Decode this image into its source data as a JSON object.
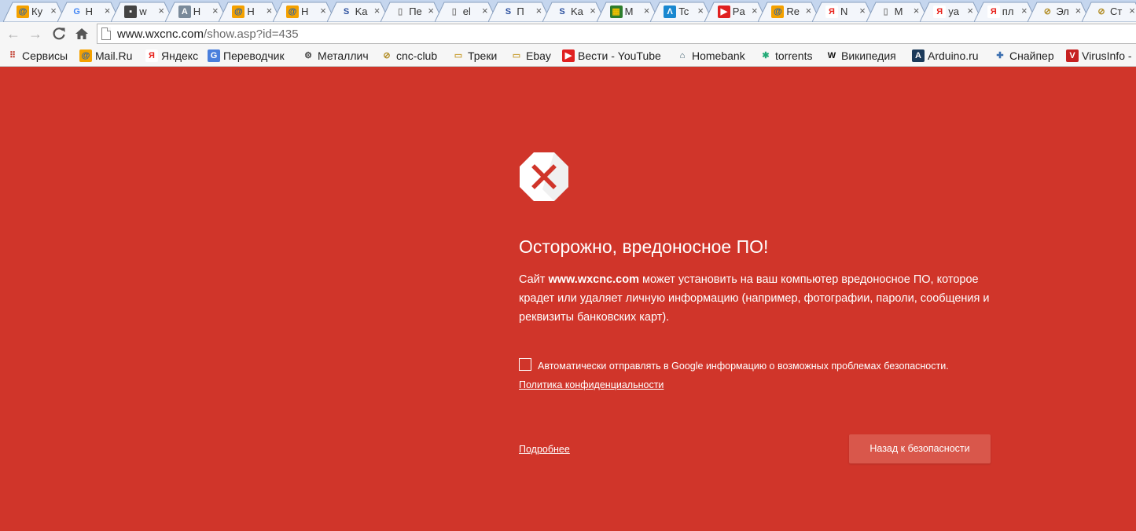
{
  "colors": {
    "page_background": "#d0352a",
    "tabstrip_background": "#c5d6ee",
    "button_background": "#d9574b",
    "text": "#ffffff"
  },
  "tabs": [
    {
      "title": "Ку",
      "icon": "mail-ru-icon"
    },
    {
      "title": "H",
      "icon": "google-icon"
    },
    {
      "title": "w",
      "icon": "site-logo-icon"
    },
    {
      "title": "H",
      "icon": "page-scan-icon"
    },
    {
      "title": "H",
      "icon": "mail-ru-icon"
    },
    {
      "title": "H",
      "icon": "mail-ru-icon"
    },
    {
      "title": "Ka",
      "icon": "s-letter-icon"
    },
    {
      "title": "Пе",
      "icon": "blank-page-icon"
    },
    {
      "title": "el",
      "icon": "blank-page-icon"
    },
    {
      "title": "П",
      "icon": "s-letter-icon"
    },
    {
      "title": "Ka",
      "icon": "s-letter-icon"
    },
    {
      "title": "M",
      "icon": "shop-icon"
    },
    {
      "title": "Tc",
      "icon": "wave-icon"
    },
    {
      "title": "Pa",
      "icon": "youtube-icon"
    },
    {
      "title": "Re",
      "icon": "mail-ru-icon"
    },
    {
      "title": "N",
      "icon": "yandex-icon"
    },
    {
      "title": "M",
      "icon": "blank-page-icon"
    },
    {
      "title": "ya",
      "icon": "yandex-icon"
    },
    {
      "title": "пл",
      "icon": "yandex-icon"
    },
    {
      "title": "Эл",
      "icon": "cnc-icon"
    },
    {
      "title": "Ст",
      "icon": "cnc-icon"
    }
  ],
  "toolbar": {
    "url_host": "www.wxcnc.com",
    "url_rest": "/show.asp?id=435"
  },
  "bookmarks": [
    {
      "label": "Сервисы",
      "icon": "apps-grid-icon"
    },
    {
      "label": "Mail.Ru",
      "icon": "mail-ru-icon"
    },
    {
      "label": "Яндекс",
      "icon": "yandex-icon"
    },
    {
      "label": "Переводчик",
      "icon": "translate-icon"
    },
    {
      "label": "Металлич",
      "icon": "gear-icon"
    },
    {
      "label": "cnc-club",
      "icon": "cnc-icon"
    },
    {
      "label": "Треки",
      "icon": "folder-icon"
    },
    {
      "label": "Ebay",
      "icon": "folder-icon"
    },
    {
      "label": "Вести - YouTube",
      "icon": "youtube-icon"
    },
    {
      "label": "Homebank",
      "icon": "home-icon"
    },
    {
      "label": "torrents",
      "icon": "torrent-icon"
    },
    {
      "label": "Википедия",
      "icon": "wikipedia-icon"
    },
    {
      "label": "Arduino.ru",
      "icon": "arduino-icon"
    },
    {
      "label": "Снайпер",
      "icon": "puzzle-icon"
    },
    {
      "label": "VirusInfo -",
      "icon": "virusinfo-icon"
    }
  ],
  "warning": {
    "icon": "malware-stop-icon",
    "title": "Осторожно, вредоносное ПО!",
    "desc_prefix": "Сайт ",
    "desc_site": "www.wxcnc.com",
    "desc_suffix": " может установить на ваш компьютер вредоносное ПО, которое крадет или удаляет личную информацию (например, фотографии, пароли, сообщения и реквизиты банковских карт).",
    "checkbox_label": "Автоматически отправлять в Google информацию о возможных проблемах безопасности.",
    "checkbox_checked": false,
    "privacy_link": "Политика конфиденциальности",
    "details_link": "Подробнее",
    "back_button": "Назад к безопасности"
  }
}
